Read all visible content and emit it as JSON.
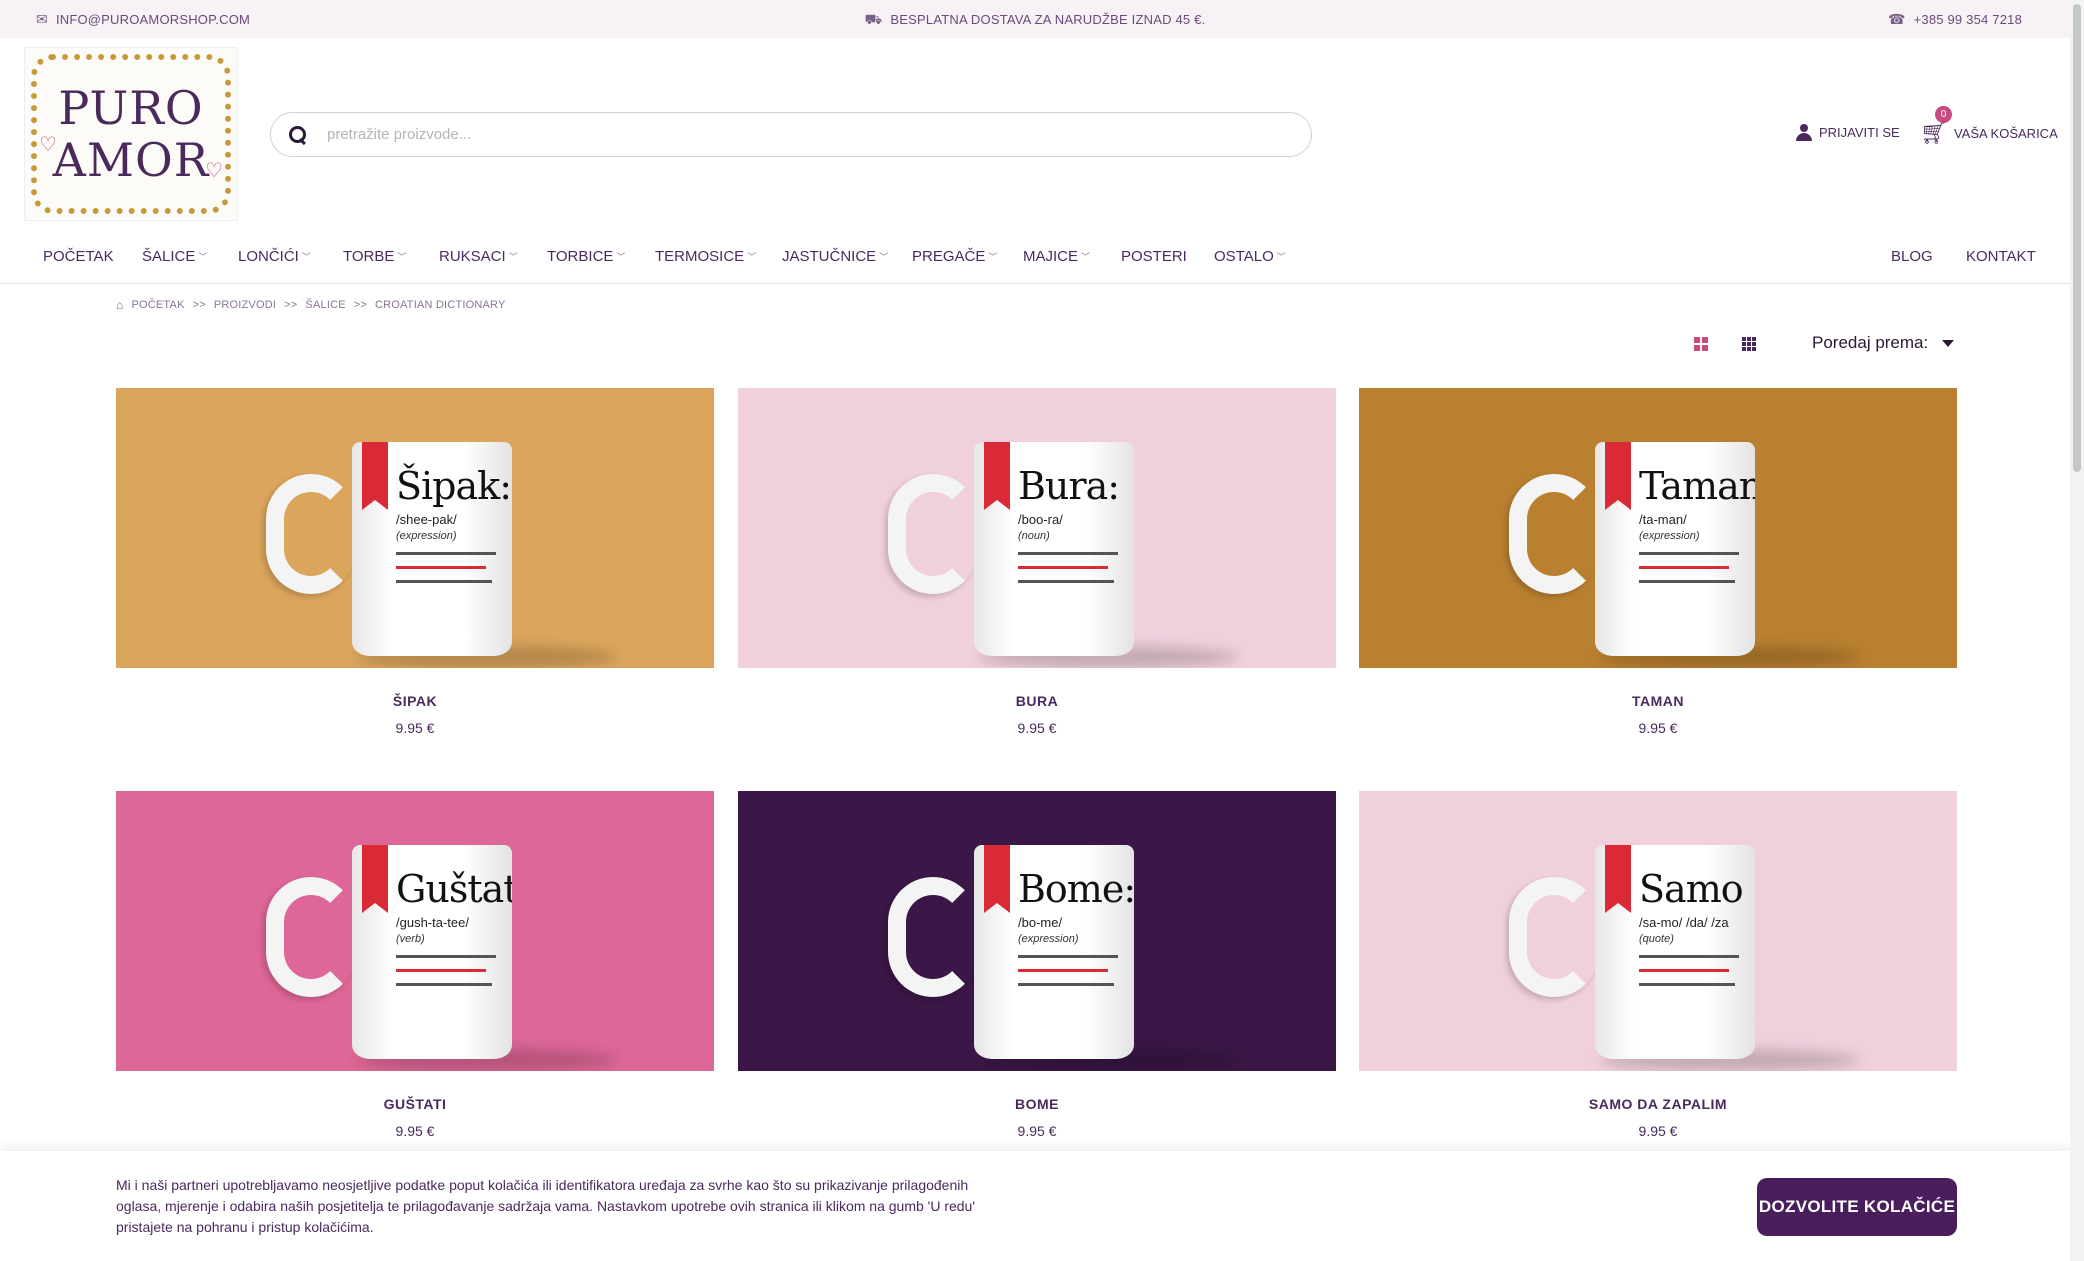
{
  "topbar": {
    "email": "INFO@PUROAMORSHOP.COM",
    "shipping": "BESPLATNA DOSTAVA ZA NARUDŽBE IZNAD 45 €.",
    "phone": "+385 99 354 7218"
  },
  "logo": {
    "line1": "PURO",
    "line2": "AMOR"
  },
  "search": {
    "placeholder": "pretražite proizvode..."
  },
  "header": {
    "login_label": "PRIJAVITI SE",
    "cart_label": "VAŠA KOŠARICA",
    "cart_count": "0"
  },
  "nav": {
    "items": [
      {
        "label": "POČETAK",
        "dropdown": false
      },
      {
        "label": "ŠALICE",
        "dropdown": true
      },
      {
        "label": "LONČIĆI",
        "dropdown": true
      },
      {
        "label": "TORBE",
        "dropdown": true
      },
      {
        "label": "RUKSACI",
        "dropdown": true
      },
      {
        "label": "TORBICE",
        "dropdown": true
      },
      {
        "label": "TERMOSICE",
        "dropdown": true
      },
      {
        "label": "JASTUČNICE",
        "dropdown": true
      },
      {
        "label": "PREGAČE",
        "dropdown": true
      },
      {
        "label": "MAJICE",
        "dropdown": true
      },
      {
        "label": "POSTERI",
        "dropdown": false
      },
      {
        "label": "OSTALO",
        "dropdown": true
      }
    ],
    "right": [
      "BLOG",
      "KONTAKT"
    ]
  },
  "breadcrumb": [
    "POČETAK",
    "PROIZVODI",
    "ŠALICE",
    "CROATIAN DICTIONARY"
  ],
  "breadcrumb_sep": ">>",
  "sort": {
    "label": "Poredaj prema:"
  },
  "products": [
    {
      "name": "ŠIPAK",
      "price": "9.95 €",
      "bg": "#dba55c",
      "mug_word": "Šipak:",
      "mug_pron": "/shee-pak/",
      "mug_type": "(expression)"
    },
    {
      "name": "BURA",
      "price": "9.95 €",
      "bg": "#f0d0dd",
      "mug_word": "Bura:",
      "mug_pron": "/boo-ra/",
      "mug_type": "(noun)"
    },
    {
      "name": "TAMAN",
      "price": "9.95 €",
      "bg": "#b98030",
      "mug_word": "Taman:",
      "mug_pron": "/ta-man/",
      "mug_type": "(expression)"
    },
    {
      "name": "GUŠTATI",
      "price": "9.95 €",
      "bg": "#dd6797",
      "mug_word": "Guštati",
      "mug_pron": "/gush-ta-tee/",
      "mug_type": "(verb)"
    },
    {
      "name": "BOME",
      "price": "9.95 €",
      "bg": "#3a1746",
      "mug_word": "Bome:",
      "mug_pron": "/bo-me/",
      "mug_type": "(expression)"
    },
    {
      "name": "SAMO DA ZAPALIM",
      "price": "9.95 €",
      "bg": "#f0d0dd",
      "mug_word": "Samo",
      "mug_pron": "/sa-mo/ /da/ /za",
      "mug_type": "(quote)"
    }
  ],
  "cookie": {
    "text": "Mi i naši partneri upotrebljavamo neosjetljive podatke poput kolačića ili identifikatora uređaja za svrhe kao što su prikazivanje prilagođenih oglasa, mjerenje i odabira naših posjetitelja te prilagođavanje sadržaja vama. Nastavkom upotrebe ovih stranica ili klikom na gumb 'U redu' pristajete na pohranu i pristup kolačićima.",
    "button": "DOZVOLITE KOLAČIĆE"
  },
  "colors": {
    "brand": "#4a2a5c",
    "accent": "#c84a7e",
    "button": "#4a1e5c"
  }
}
